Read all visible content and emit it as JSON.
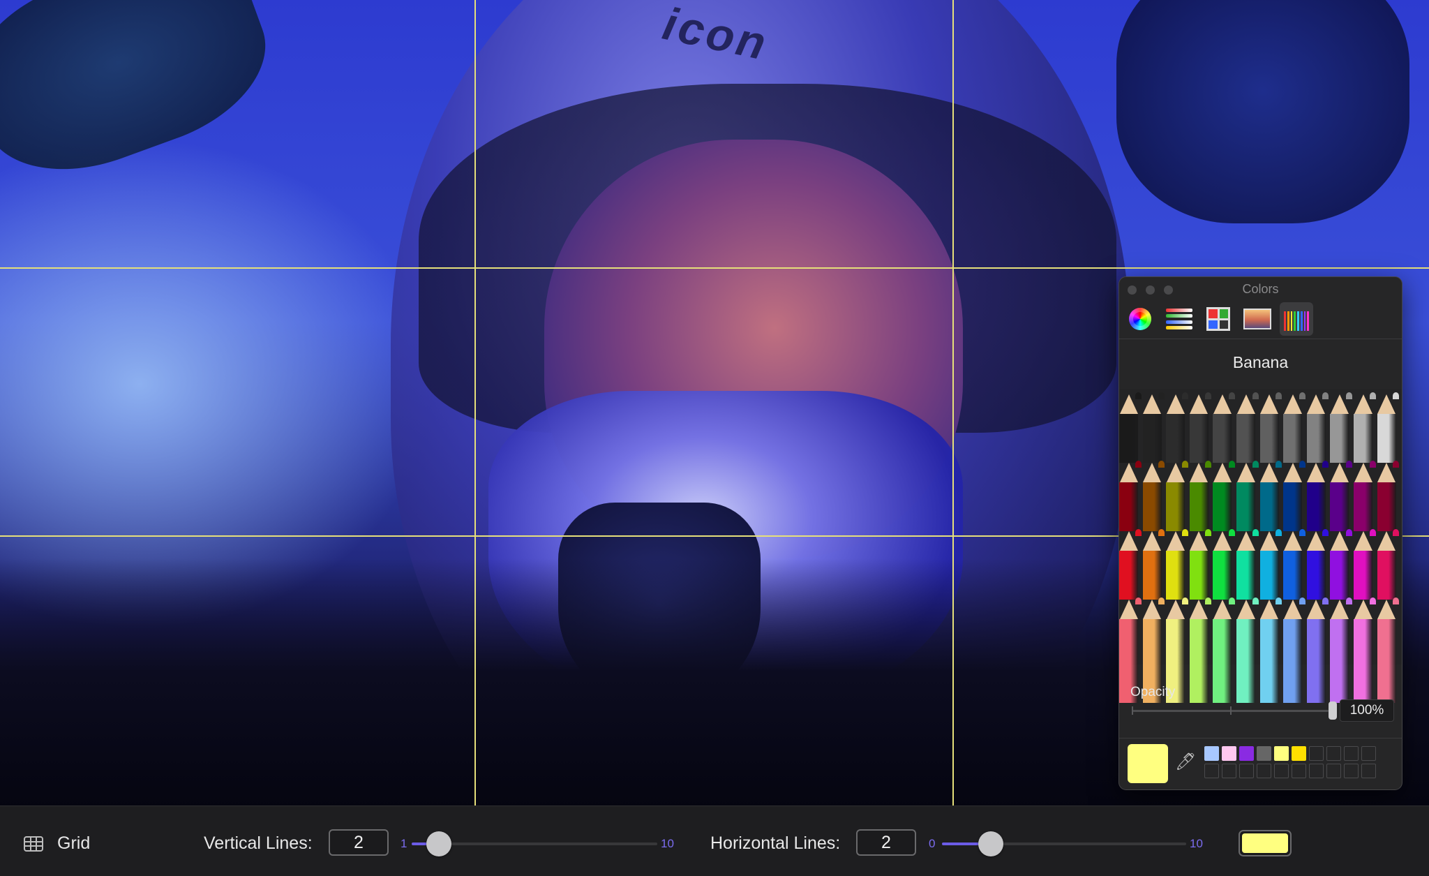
{
  "photo": {
    "brand_text": "icon"
  },
  "grid_color": "#e6e07a",
  "colors_panel": {
    "title": "Colors",
    "toolbar": [
      {
        "name": "color-wheel-icon",
        "selected": false
      },
      {
        "name": "color-sliders-icon",
        "selected": false
      },
      {
        "name": "color-palettes-icon",
        "selected": false
      },
      {
        "name": "image-palettes-icon",
        "selected": false
      },
      {
        "name": "pencils-icon",
        "selected": true
      }
    ],
    "selected_color_name": "Banana",
    "pencil_rows": [
      [
        "#1a1a1a",
        "#222222",
        "#2c2c2c",
        "#383838",
        "#444444",
        "#525252",
        "#606060",
        "#707070",
        "#828282",
        "#979797",
        "#b0b0b0",
        "#d8d8d8"
      ],
      [
        "#8a0010",
        "#8a4a00",
        "#8a8a00",
        "#4a8a00",
        "#008a20",
        "#008a60",
        "#006a8a",
        "#00358a",
        "#20008a",
        "#5a008a",
        "#8a006a",
        "#8a0030"
      ],
      [
        "#e01020",
        "#e07010",
        "#e0e010",
        "#80e010",
        "#10e040",
        "#10e0a0",
        "#10b0e0",
        "#1060e0",
        "#3010e0",
        "#9010e0",
        "#e010c0",
        "#e01060"
      ],
      [
        "#f06070",
        "#f0b060",
        "#f0f080",
        "#b0f060",
        "#70f080",
        "#70f0c0",
        "#70d0f0",
        "#70a0f0",
        "#8070f0",
        "#c070f0",
        "#f070e0",
        "#f07090"
      ]
    ],
    "opacity": {
      "label": "Opacity",
      "value": "100%"
    },
    "current_color": "#ffff80",
    "swatches": [
      "#a8c8ff",
      "#ffc8f0",
      "#8a2be2",
      "#666666",
      "#ffff80",
      "#ffe000",
      "",
      "",
      "",
      "",
      "",
      "",
      "",
      "",
      "",
      "",
      "",
      "",
      "",
      ""
    ]
  },
  "bottom_bar": {
    "grid_label": "Grid",
    "vertical": {
      "label": "Vertical Lines:",
      "value": "2",
      "min": "1",
      "max": "10",
      "fraction": 0.11
    },
    "horizontal": {
      "label": "Horizontal Lines:",
      "value": "2",
      "min": "0",
      "max": "10",
      "fraction": 0.2
    },
    "line_color": "#ffff80"
  }
}
